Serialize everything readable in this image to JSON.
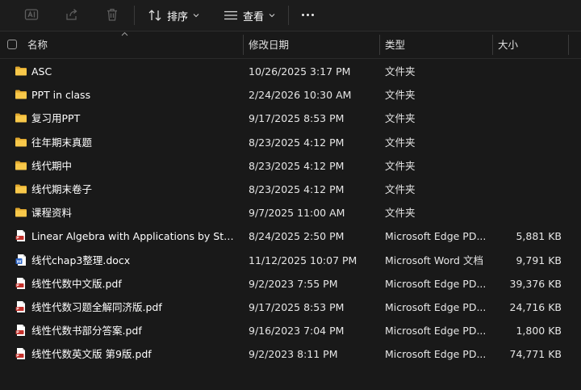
{
  "toolbar": {
    "sort_label": "排序",
    "view_label": "查看"
  },
  "columns": {
    "name": "名称",
    "date": "修改日期",
    "type": "类型",
    "size": "大小"
  },
  "files": [
    {
      "icon": "folder-icon",
      "name": "ASC",
      "date": "10/26/2025 3:17 PM",
      "type": "文件夹",
      "size": ""
    },
    {
      "icon": "folder-icon",
      "name": "PPT in class",
      "date": "2/24/2026 10:30 AM",
      "type": "文件夹",
      "size": ""
    },
    {
      "icon": "folder-icon",
      "name": "复习用PPT",
      "date": "9/17/2025 8:53 PM",
      "type": "文件夹",
      "size": ""
    },
    {
      "icon": "folder-icon",
      "name": "往年期末真题",
      "date": "8/23/2025 4:12 PM",
      "type": "文件夹",
      "size": ""
    },
    {
      "icon": "folder-icon",
      "name": "线代期中",
      "date": "8/23/2025 4:12 PM",
      "type": "文件夹",
      "size": ""
    },
    {
      "icon": "folder-icon",
      "name": "线代期末卷子",
      "date": "8/23/2025 4:12 PM",
      "type": "文件夹",
      "size": ""
    },
    {
      "icon": "folder-icon",
      "name": "课程资料",
      "date": "9/7/2025 11:00 AM",
      "type": "文件夹",
      "size": ""
    },
    {
      "icon": "pdf-icon",
      "name": "Linear Algebra with Applications by Stev...",
      "date": "8/24/2025 2:50 PM",
      "type": "Microsoft Edge PD...",
      "size": "5,881 KB"
    },
    {
      "icon": "word-icon",
      "name": "线代chap3整理.docx",
      "date": "11/12/2025 10:07 PM",
      "type": "Microsoft Word 文档",
      "size": "9,791 KB"
    },
    {
      "icon": "pdf-icon",
      "name": "线性代数中文版.pdf",
      "date": "9/2/2023 7:55 PM",
      "type": "Microsoft Edge PD...",
      "size": "39,376 KB"
    },
    {
      "icon": "pdf-icon",
      "name": "线性代数习题全解同济版.pdf",
      "date": "9/17/2025 8:53 PM",
      "type": "Microsoft Edge PD...",
      "size": "24,716 KB"
    },
    {
      "icon": "pdf-icon",
      "name": "线性代数书部分答案.pdf",
      "date": "9/16/2023 7:04 PM",
      "type": "Microsoft Edge PD...",
      "size": "1,800 KB"
    },
    {
      "icon": "pdf-icon",
      "name": "线性代数英文版 第9版.pdf",
      "date": "9/2/2023 8:11 PM",
      "type": "Microsoft Edge PD...",
      "size": "74,771 KB"
    }
  ]
}
